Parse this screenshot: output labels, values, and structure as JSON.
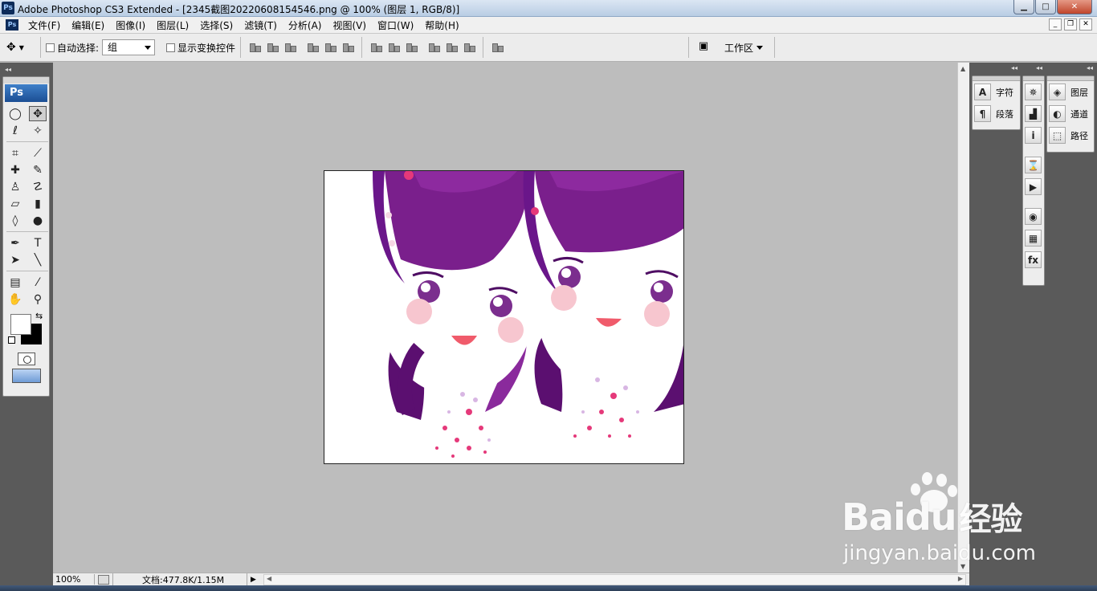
{
  "window": {
    "app_icon": "Ps",
    "title": "Adobe Photoshop CS3 Extended - [2345截图20220608154546.png @ 100% (图层 1, RGB/8)]",
    "controls": {
      "minimize": "▁",
      "maximize": "□",
      "close": "✕"
    }
  },
  "menu": {
    "logo": "Ps",
    "items": [
      "文件(F)",
      "编辑(E)",
      "图像(I)",
      "图层(L)",
      "选择(S)",
      "滤镜(T)",
      "分析(A)",
      "视图(V)",
      "窗口(W)",
      "帮助(H)"
    ],
    "doc_controls": {
      "minimize": "_",
      "restore": "❐",
      "close": "✕"
    }
  },
  "options_bar": {
    "tool_icon": "move-tool-icon",
    "auto_select_label": "自动选择:",
    "auto_select_checked": false,
    "auto_select_value": "组",
    "show_transform_label": "显示变换控件",
    "show_transform_checked": false,
    "workspace_label": "工作区"
  },
  "toolbox": {
    "logo": "Ps",
    "foreground_color": "#ffffff",
    "background_color": "#000000",
    "tools": [
      {
        "name": "marquee-tool-icon",
        "glyph": "◯"
      },
      {
        "name": "move-tool-icon",
        "glyph": "✥",
        "active": true
      },
      {
        "name": "lasso-tool-icon",
        "glyph": "ℓ"
      },
      {
        "name": "magic-wand-tool-icon",
        "glyph": "✧"
      },
      {
        "name": "crop-tool-icon",
        "glyph": "⌗"
      },
      {
        "name": "slice-tool-icon",
        "glyph": "⟋"
      },
      {
        "name": "healing-brush-tool-icon",
        "glyph": "✚"
      },
      {
        "name": "brush-tool-icon",
        "glyph": "✎"
      },
      {
        "name": "clone-stamp-tool-icon",
        "glyph": "♙"
      },
      {
        "name": "history-brush-tool-icon",
        "glyph": "☡"
      },
      {
        "name": "eraser-tool-icon",
        "glyph": "▱"
      },
      {
        "name": "gradient-tool-icon",
        "glyph": "▮"
      },
      {
        "name": "blur-tool-icon",
        "glyph": "◊"
      },
      {
        "name": "dodge-tool-icon",
        "glyph": "●"
      },
      {
        "name": "pen-tool-icon",
        "glyph": "✒"
      },
      {
        "name": "type-tool-icon",
        "glyph": "T"
      },
      {
        "name": "path-selection-tool-icon",
        "glyph": "➤"
      },
      {
        "name": "line-tool-icon",
        "glyph": "╲"
      },
      {
        "name": "notes-tool-icon",
        "glyph": "▤"
      },
      {
        "name": "eyedropper-tool-icon",
        "glyph": "⁄"
      },
      {
        "name": "hand-tool-icon",
        "glyph": "✋"
      },
      {
        "name": "zoom-tool-icon",
        "glyph": "⚲"
      }
    ]
  },
  "panels": {
    "group1": [
      {
        "icon": "character-icon",
        "glyph": "A",
        "label": "字符"
      },
      {
        "icon": "paragraph-icon",
        "glyph": "¶",
        "label": "段落"
      }
    ],
    "group2_icons": [
      {
        "icon": "navigator-icon",
        "glyph": "✵"
      },
      {
        "icon": "histogram-icon",
        "glyph": "▟"
      },
      {
        "icon": "info-icon",
        "glyph": "i"
      },
      {
        "icon": "history-icon",
        "glyph": "⌛"
      },
      {
        "icon": "actions-icon",
        "glyph": "▶"
      },
      {
        "icon": "color-icon",
        "glyph": "◉"
      },
      {
        "icon": "swatches-icon",
        "glyph": "▦"
      },
      {
        "icon": "styles-icon",
        "glyph": "fx"
      }
    ],
    "group3": [
      {
        "icon": "layers-icon",
        "glyph": "◈",
        "label": "图层"
      },
      {
        "icon": "channels-icon",
        "glyph": "◐",
        "label": "通道"
      },
      {
        "icon": "paths-icon",
        "glyph": "⬚",
        "label": "路径"
      }
    ]
  },
  "status": {
    "zoom": "100%",
    "doc_info": "文档:477.8K/1.15M"
  },
  "watermark": {
    "brand": "Bai",
    "brand2": "du",
    "brand_cn": "经验",
    "url": "jingyan.baidu.com"
  },
  "colors": {
    "hair": "#7a1f8c",
    "hair_dark": "#4e0d63",
    "cheek": "#f7c6cf",
    "mouth": "#f05b6b",
    "dots": "#e5397a"
  }
}
